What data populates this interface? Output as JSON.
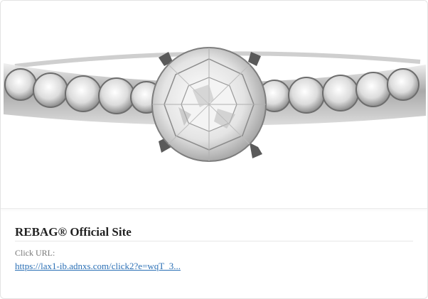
{
  "ad": {
    "image_subject": "diamond-engagement-ring",
    "title": "REBAG® Official Site",
    "click_label": "Click URL:",
    "click_url_text": "https://lax1-ib.adnxs.com/click2?e=wqT_3...",
    "link_color": "#2a6fb5"
  }
}
